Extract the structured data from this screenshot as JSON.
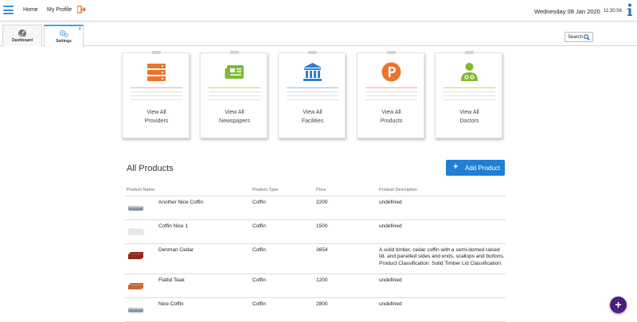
{
  "topbar": {
    "home": "Home",
    "profile": "My Profile",
    "date": "Wednesday 08 Jan 2020",
    "time": "11:30:56"
  },
  "tabs": [
    {
      "label": "Dashboard"
    },
    {
      "label": "Settings",
      "close": "×"
    }
  ],
  "search": {
    "label": "Search"
  },
  "cards": [
    {
      "line1": "View All",
      "line2": "Providers",
      "color": "#e8762d",
      "icon": "server-stack-icon"
    },
    {
      "line1": "View All",
      "line2": "Newspapers",
      "color": "#7dbb2e",
      "icon": "newspaper-icon"
    },
    {
      "line1": "View All",
      "line2": "Facilities",
      "color": "#2f7fd0",
      "icon": "building-icon"
    },
    {
      "line1": "View All",
      "line2": "Products",
      "color": "#e8762d",
      "icon": "product-p-icon"
    },
    {
      "line1": "View All",
      "line2": "Doctors",
      "color": "#7dbb2e",
      "icon": "doctor-icon"
    }
  ],
  "section": {
    "title": "All Products",
    "add_label": "Add Product",
    "add_plus": "+"
  },
  "table": {
    "headers": [
      "Product Name",
      "Product Type",
      "Price",
      "Product Description"
    ],
    "rows": [
      {
        "name": "Another Nice Coffin",
        "type": "Coffin",
        "price": "2200",
        "desc": "undefined",
        "thumb": "#8c96a6"
      },
      {
        "name": "Coffin Nice 1",
        "type": "Coffin",
        "price": "1500",
        "desc": "undefined",
        "thumb": "#e6e6e6"
      },
      {
        "name": "Denman Cedar",
        "type": "Coffin",
        "price": "3654",
        "desc": "A solid timber, cedar coffin with a semi-domed raised lid, and panelled sides and ends, scallops and buttons. Product Classification: Solid Timber Lid Classification:",
        "thumb": "#8f2a1c"
      },
      {
        "name": "Flatlid Teak",
        "type": "Coffin",
        "price": "1200",
        "desc": "undefined",
        "thumb": "#c8672a"
      },
      {
        "name": "Nice Coffin",
        "type": "Coffin",
        "price": "2800",
        "desc": "undefined",
        "thumb": "#8c96a6"
      }
    ]
  },
  "fab": {
    "label": "+"
  },
  "colors": {
    "accent": "#1f7fd4",
    "fab": "#4b1e7d",
    "orange": "#e8762d",
    "green": "#7dbb2e"
  }
}
